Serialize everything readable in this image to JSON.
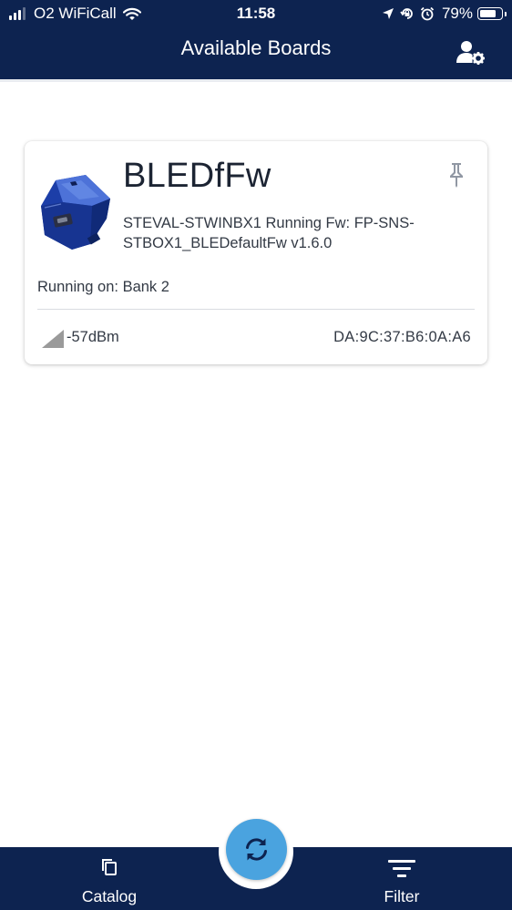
{
  "status_bar": {
    "carrier": "O2 WiFiCall",
    "time": "11:58",
    "battery_percent": "79%",
    "battery_level": 0.79,
    "signal_bars": 3,
    "signal_bars_total": 4
  },
  "header": {
    "title": "Available Boards",
    "user_settings_icon": "user-gear-icon",
    "background_color": "#0d2350"
  },
  "board": {
    "name": "BLEDfFw",
    "description": "STEVAL-STWINBX1 Running Fw: FP-SNS-STBOX1_BLEDefaultFw v1.6.0",
    "running_on": "Running on: Bank 2",
    "rssi": "-57dBm",
    "mac_address": "DA:9C:37:B6:0A:A6",
    "pin_icon": "pin-icon",
    "signal_icon": "signal-strength-icon",
    "image": "board-device-image"
  },
  "bottom_nav": {
    "catalog_label": "Catalog",
    "catalog_icon": "copy-icon",
    "filter_label": "Filter",
    "filter_icon": "filter-icon",
    "refresh_icon": "refresh-icon",
    "accent_color": "#4aa3df"
  }
}
